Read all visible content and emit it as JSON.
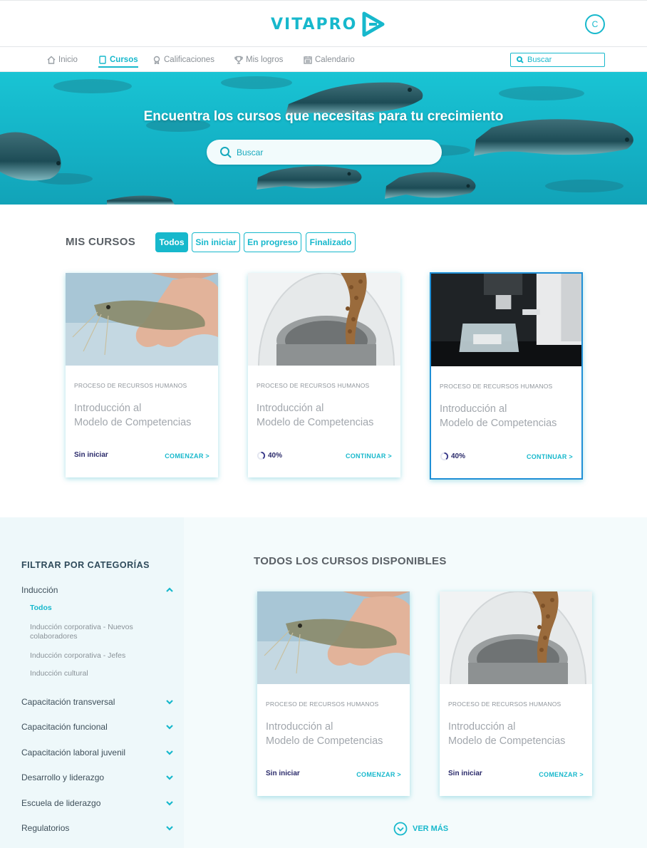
{
  "header": {
    "logo_text": "VITAPRO",
    "avatar_initial": "C"
  },
  "nav": {
    "items": [
      {
        "label": "Inicio",
        "icon": "home-icon",
        "active": false
      },
      {
        "label": "Cursos",
        "icon": "book-icon",
        "active": true
      },
      {
        "label": "Calificaciones",
        "icon": "badge-icon",
        "active": false
      },
      {
        "label": "Mis logros",
        "icon": "trophy-icon",
        "active": false
      },
      {
        "label": "Calendario",
        "icon": "calendar-icon",
        "active": false
      }
    ],
    "search_placeholder": "Buscar"
  },
  "hero": {
    "title": "Encuentra los cursos que necesitas para tu crecimiento",
    "search_placeholder": "Buscar"
  },
  "my_courses": {
    "title": "MIS CURSOS",
    "filters": [
      "Todos",
      "Sin iniciar",
      "En progreso",
      "Finalizado"
    ],
    "active_filter": "Todos",
    "cards": [
      {
        "image": "shrimp",
        "category": "PROCESO DE RECURSOS HUMANOS",
        "title_line1": "Introducción al",
        "title_line2": "Modelo de Competencias",
        "status": "Sin iniciar",
        "progress": null,
        "action": "COMENZAR >"
      },
      {
        "image": "feed",
        "category": "PROCESO DE RECURSOS HUMANOS",
        "title_line1": "Introducción al",
        "title_line2": "Modelo de Competencias",
        "status": "40%",
        "progress": 0.4,
        "action": "CONTINUAR >"
      },
      {
        "image": "lab",
        "category": "PROCESO DE RECURSOS HUMANOS",
        "title_line1": "Introducción al",
        "title_line2": "Modelo de Competencias",
        "status": "40%",
        "progress": 0.4,
        "action": "CONTINUAR >",
        "selected": true
      }
    ]
  },
  "sidebar": {
    "title": "FILTRAR POR CATEGORÍAS",
    "categories": [
      {
        "label": "Inducción",
        "expanded": true
      },
      {
        "label": "Capacitación transversal",
        "expanded": false
      },
      {
        "label": "Capacitación funcional",
        "expanded": false
      },
      {
        "label": "Capacitación laboral juvenil",
        "expanded": false
      },
      {
        "label": "Desarrollo y liderazgo",
        "expanded": false
      },
      {
        "label": "Escuela de liderazgo",
        "expanded": false
      },
      {
        "label": "Regulatorios",
        "expanded": false
      }
    ],
    "subitems": [
      "Todos",
      "Inducción corporativa - Nuevos colaboradores",
      "Inducción corporativa - Jefes",
      "Inducción cultural"
    ],
    "active_subitem": "Todos"
  },
  "all_courses": {
    "title": "TODOS LOS CURSOS DISPONIBLES",
    "cards": [
      {
        "image": "shrimp",
        "category": "PROCESO DE RECURSOS HUMANOS",
        "title_line1": "Introducción al",
        "title_line2": "Modelo de Competencias",
        "status": "Sin iniciar",
        "action": "COMENZAR >"
      },
      {
        "image": "feed",
        "category": "PROCESO DE RECURSOS HUMANOS",
        "title_line1": "Introducción al",
        "title_line2": "Modelo de Competencias",
        "status": "Sin iniciar",
        "action": "COMENZAR >"
      }
    ],
    "more_label": "VER MÁS"
  },
  "colors": {
    "accent": "#17b8cc",
    "selected_border": "#1f8fd6",
    "status_text": "#2b2b6b"
  }
}
